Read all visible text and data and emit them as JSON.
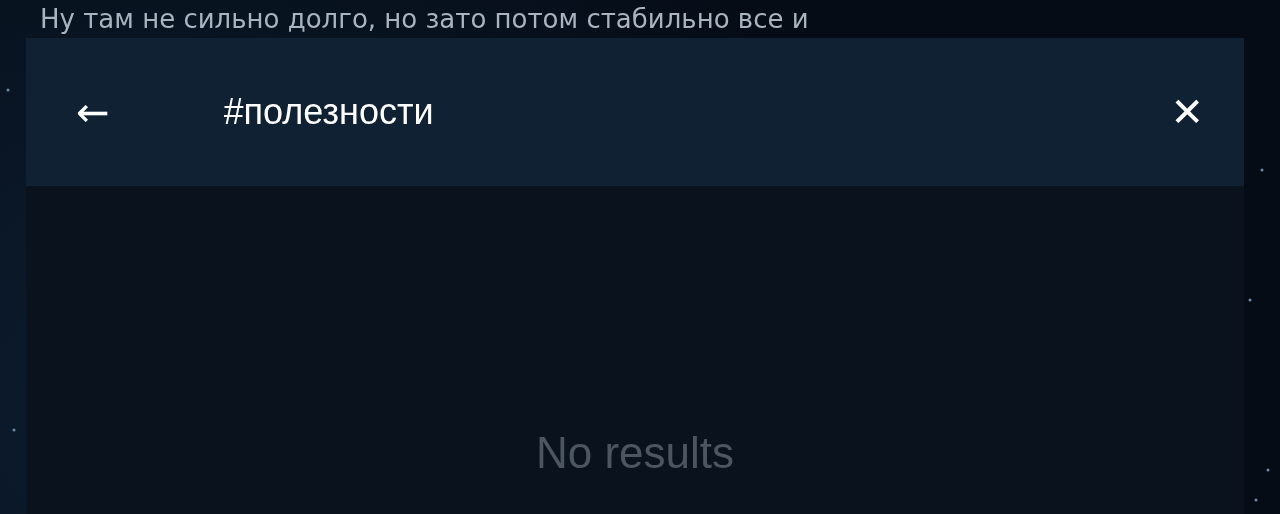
{
  "background_message": "Ну там не сильно долго, но зато потом стабильно все и",
  "search_bar": {
    "back": "←",
    "query": "#полезности",
    "close": "✕"
  },
  "results": {
    "empty_text": "No results"
  }
}
